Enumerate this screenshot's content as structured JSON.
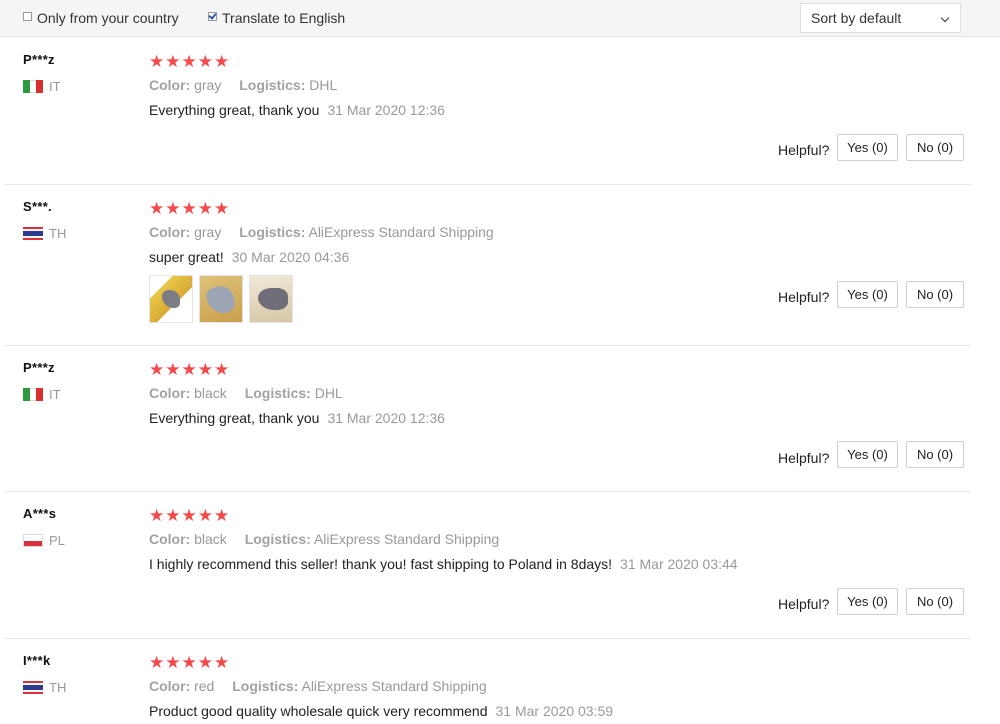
{
  "filters": {
    "only_country_label": "Only from your country",
    "only_country_checked": false,
    "translate_label": "Translate to English",
    "translate_checked": true
  },
  "sort": {
    "selected": "Sort by default"
  },
  "colors": {
    "star": "#f44a4a",
    "muted": "#999999"
  },
  "common": {
    "color_label": "Color:",
    "logistics_label": "Logistics:",
    "helpful_label": "Helpful?",
    "stars": "★★★★★"
  },
  "reviews": [
    {
      "user": "P***z",
      "country": "IT",
      "flag": "italy-flag-icon",
      "rating": 5,
      "color": "gray",
      "logistics": "DHL",
      "text": "Everything great, thank you",
      "date": "31 Mar 2020 12:36",
      "yes": "Yes (0)",
      "no": "No (0)",
      "photos": 0
    },
    {
      "user": "S***.",
      "country": "TH",
      "flag": "thailand-flag-icon",
      "rating": 5,
      "color": "gray",
      "logistics": "AliExpress Standard Shipping",
      "text": "super great!",
      "date": "30 Mar 2020 04:36",
      "yes": "Yes (0)",
      "no": "No (0)",
      "photos": 3
    },
    {
      "user": "P***z",
      "country": "IT",
      "flag": "italy-flag-icon",
      "rating": 5,
      "color": "black",
      "logistics": "DHL",
      "text": "Everything great, thank you",
      "date": "31 Mar 2020 12:36",
      "yes": "Yes (0)",
      "no": "No (0)",
      "photos": 0
    },
    {
      "user": "A***s",
      "country": "PL",
      "flag": "poland-flag-icon",
      "rating": 5,
      "color": "black",
      "logistics": "AliExpress Standard Shipping",
      "text": "I highly recommend this seller! thank you! fast shipping to Poland in 8days!",
      "date": "31 Mar 2020 03:44",
      "yes": "Yes (0)",
      "no": "No (0)",
      "photos": 0
    },
    {
      "user": "I***k",
      "country": "TH",
      "flag": "thailand-flag-icon",
      "rating": 5,
      "color": "red",
      "logistics": "AliExpress Standard Shipping",
      "text": "Product good quality wholesale quick very recommend",
      "date": "31 Mar 2020 03:59",
      "photos": 0
    }
  ]
}
